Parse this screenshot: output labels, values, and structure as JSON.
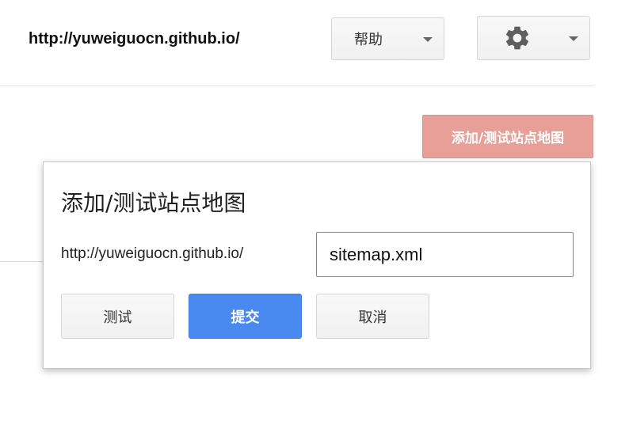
{
  "header": {
    "site_url": "http://yuweiguocn.github.io/",
    "help_label": "帮助",
    "settings_icon": "gear-icon"
  },
  "toolbar": {
    "add_sitemap_label": "添加/测试站点地图",
    "add_sitemap_color": "#e89f97"
  },
  "dialog": {
    "title": "添加/测试站点地图",
    "url_prefix": "http://yuweiguocn.github.io/",
    "sitemap_value": "sitemap.xml",
    "test_label": "测试",
    "submit_label": "提交",
    "cancel_label": "取消",
    "submit_color": "#4a89f0",
    "focus_color": "#4d90fe"
  }
}
